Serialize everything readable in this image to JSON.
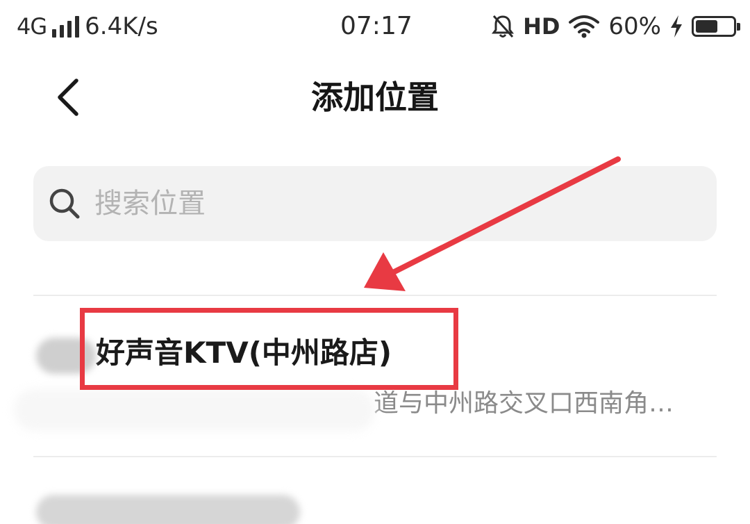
{
  "status_bar": {
    "network": "4G",
    "speed": "6.4K/s",
    "time": "07:17",
    "hd": "HD",
    "battery_percent": "60%",
    "battery_level": 0.6
  },
  "header": {
    "title": "添加位置"
  },
  "search": {
    "placeholder": "搜索位置",
    "value": ""
  },
  "locations": [
    {
      "name": "好声音KTV(中州路店)",
      "address": "道与中州路交叉口西南角…"
    }
  ],
  "colors": {
    "accent_red": "#e83a43",
    "search_bg": "#f2f2f2",
    "text_primary": "#1a1a1a",
    "text_secondary": "#8a8a8a",
    "divider": "#ececec"
  },
  "icons": {
    "back": "chevron-left-icon",
    "search": "search-icon",
    "mute": "bell-off-icon",
    "wifi": "wifi-icon",
    "charging": "bolt-icon",
    "battery": "battery-icon"
  }
}
